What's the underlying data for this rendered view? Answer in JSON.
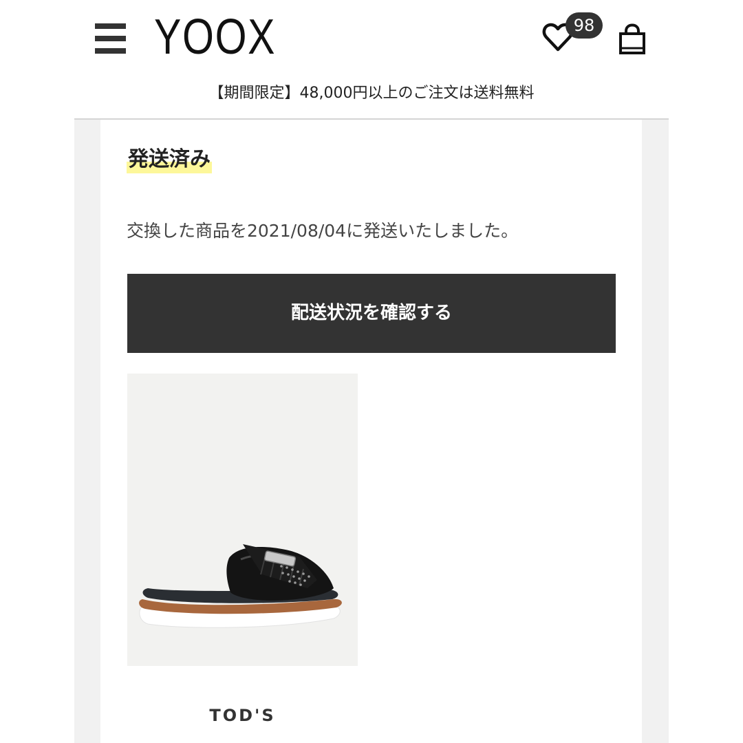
{
  "header": {
    "logo": "YOOX",
    "wishlist_count": "98",
    "icons": {
      "menu": "hamburger-menu-icon",
      "wishlist": "heart-icon",
      "bag": "shopping-bag-icon"
    }
  },
  "promo": {
    "text": "【期間限定】48,000円以上のご注文は送料無料"
  },
  "order": {
    "status_title": "発送済み",
    "status_message": "交換した商品を2021/08/04に発送いたしました。",
    "track_button_label": "配送状況を確認する"
  },
  "product": {
    "brand": "TOD'S",
    "image_alt": "black studded fringe platform slide sandal"
  },
  "colors": {
    "dark": "#333333",
    "highlight": "#fdf79a",
    "side_panel": "#f1f1f1",
    "image_bg": "#f2f2f0"
  }
}
